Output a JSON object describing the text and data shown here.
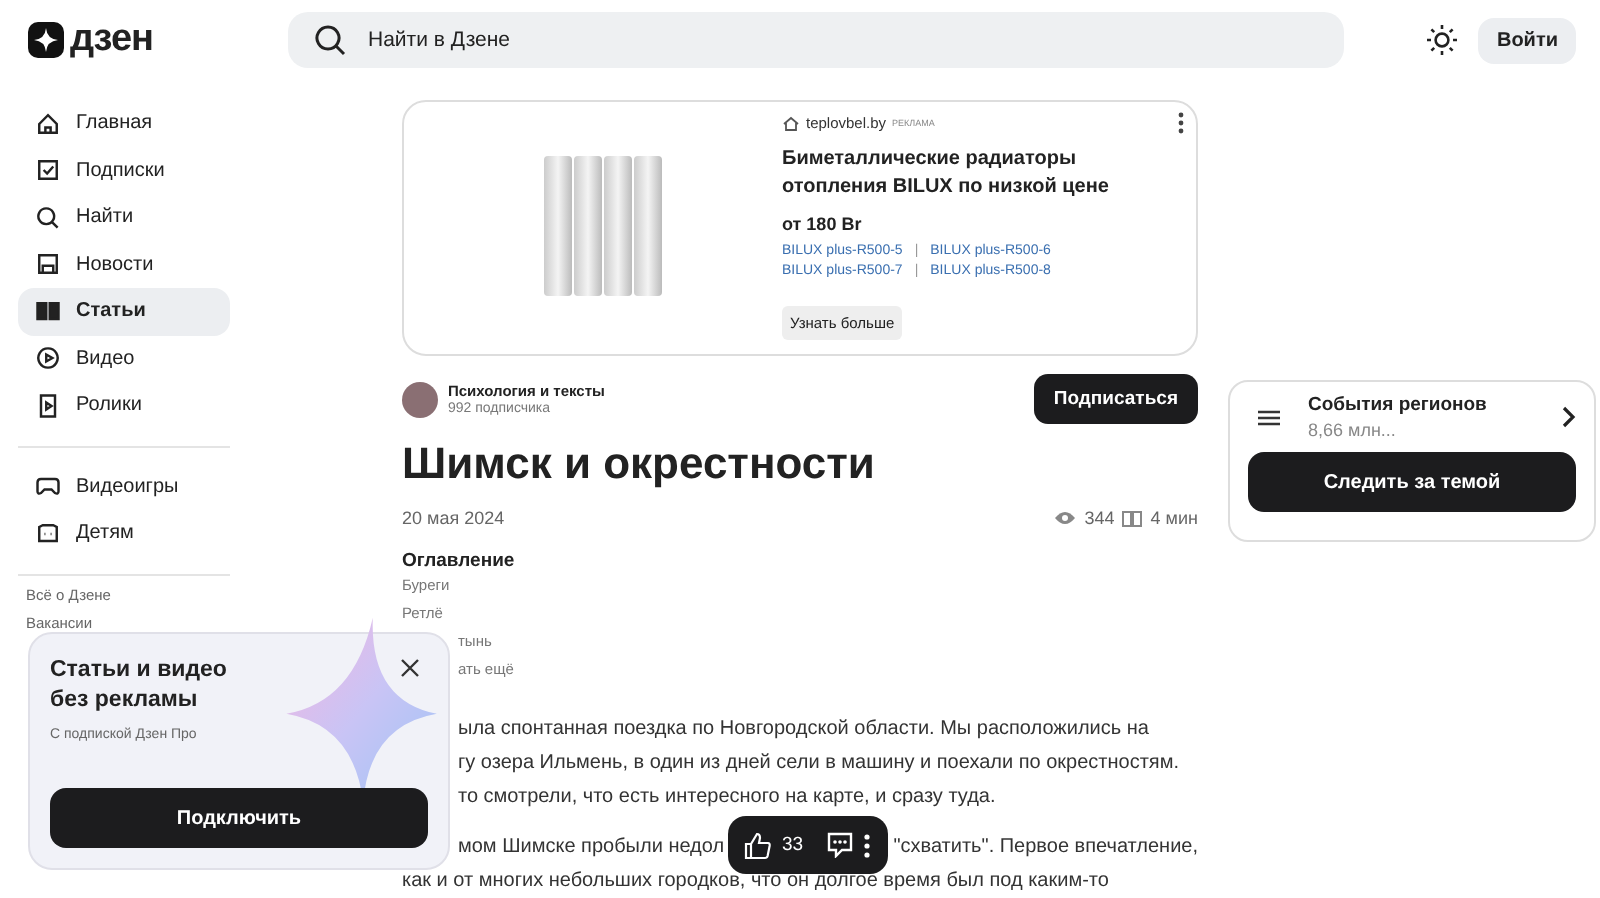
{
  "header": {
    "logo": "дзен",
    "search_placeholder": "Найти в Дзене",
    "login": "Войти"
  },
  "sidebar": {
    "items": [
      {
        "label": "Главная",
        "selected": false
      },
      {
        "label": "Подписки",
        "selected": false
      },
      {
        "label": "Найти",
        "selected": false
      },
      {
        "label": "Новости",
        "selected": false
      },
      {
        "label": "Статьи",
        "selected": true
      },
      {
        "label": "Видео",
        "selected": false
      },
      {
        "label": "Ролики",
        "selected": false
      }
    ],
    "items_2": [
      {
        "label": "Видеоигры",
        "selected": false
      },
      {
        "label": "Детям",
        "selected": false
      }
    ],
    "links": [
      "Всё о Дзене",
      "Вакансии"
    ]
  },
  "ad": {
    "domain": "teplovbel.by",
    "tag": "РЕКЛАМА",
    "title": "Биметаллические радиаторы отопления BILUX по низкой цене",
    "price": "от 180 Br",
    "links": [
      "BILUX plus-R500-5",
      "BILUX plus-R500-6",
      "BILUX plus-R500-7",
      "BILUX plus-R500-8"
    ],
    "separators": [
      "|",
      "|"
    ],
    "button": "Узнать больше"
  },
  "article": {
    "channel": "Психология и тексты",
    "subscribers": "992 подписчика",
    "subscribe": "Подписаться",
    "title": "Шимск и окрестности",
    "date": "20 мая 2024",
    "views": "344",
    "read_time": "4 мин",
    "toc": {
      "heading": "Оглавление",
      "items": [
        "Буреги",
        "Ретлё"
      ],
      "items_partly_hidden": [
        "тынь",
        "ать ещё"
      ]
    },
    "lines_partly_hidden": [
      {
        "parts": [
          "ыла спонтанная поездка по Новгородской области. Мы расположились на"
        ]
      },
      {
        "parts": [
          "гу озера Ильмень, в один из дней сели в машину и поехали по окрестностям."
        ]
      },
      {
        "parts": [
          "то смотрели, что есть интересного на карте, и сразу туда."
        ]
      },
      {
        "parts": [
          "мом Шимске пробыли недол",
          "\"схватить\". Первое впечатление,"
        ]
      }
    ],
    "lines": [
      {
        "parts": [
          "как и от многих небольших городков, что он долгое время был под каким-то"
        ]
      }
    ]
  },
  "topic": {
    "title": "События регионов",
    "count": "8,66 млн...",
    "button": "Следить за темой"
  },
  "promo": {
    "title": "Статьи и видео без рекламы",
    "subtitle": "С подпиской Дзен Про",
    "button": "Подключить"
  },
  "reactions": {
    "likes": "33"
  }
}
